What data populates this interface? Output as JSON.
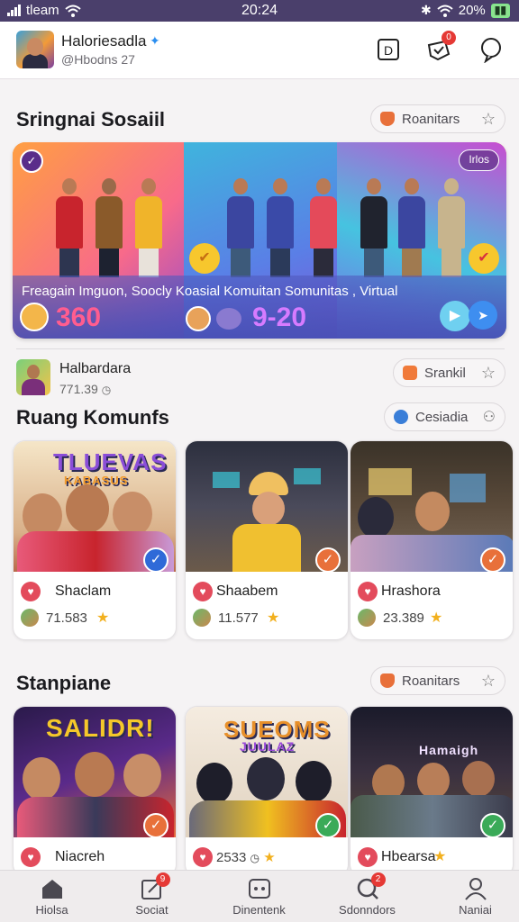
{
  "status": {
    "carrier": "tleam",
    "time": "20:24",
    "battery": "20%"
  },
  "profile": {
    "name": "Haloriesadla",
    "handle": "@Hbodns 27"
  },
  "header_icons": {
    "notification_badge": "0"
  },
  "section1": {
    "title": "Sringnai Sosaiil",
    "chip_label": "Roanitars",
    "banner": {
      "tag": "Irlos",
      "caption": "Freagain Imguon, Soocly Koasial Komuitan Somunitas , Virtual",
      "stat_a": "360",
      "stat_b": "9-20"
    }
  },
  "featured_user": {
    "name": "Halbardara",
    "stat": "771.39",
    "chip_label": "Srankil"
  },
  "section2": {
    "title": "Ruang Komunfs",
    "chip_label": "Cesiadia",
    "cards": [
      {
        "scene_text": "TLUEVAS",
        "scene_sub": "KABASUS",
        "title": "Shaclam",
        "stat": "71.583"
      },
      {
        "scene_text": "",
        "scene_sub": "",
        "title": "Shaabem",
        "stat": "11.577"
      },
      {
        "scene_text": "",
        "scene_sub": "",
        "title": "Hrashora",
        "stat": "23.389"
      }
    ]
  },
  "section3": {
    "title": "Stanpiane",
    "chip_label": "Roanitars",
    "cards": [
      {
        "scene_text": "SALIDR!",
        "title": "Niacreh",
        "stat": ""
      },
      {
        "scene_text": "SUEOMS",
        "scene_sub": "JUULAZ",
        "title": "",
        "stat": "2533"
      },
      {
        "scene_text": "Hamaigh",
        "title": "Hbearsa",
        "stat": ""
      }
    ]
  },
  "tabs": [
    {
      "label": "Hiolsa",
      "icon": "home-icon"
    },
    {
      "label": "Sociat",
      "icon": "edit-icon",
      "badge": "9"
    },
    {
      "label": "Dinentenk",
      "icon": "chat-icon"
    },
    {
      "label": "Sdonndors",
      "icon": "search-icon",
      "badge": "2"
    },
    {
      "label": "Naniai",
      "icon": "profile-icon"
    }
  ],
  "colors": {
    "status_bg": "#4a3f6b",
    "accent_red": "#e34b5c",
    "check_orange": "#e8703a",
    "check_blue": "#2f6ad8",
    "check_green": "#3aaa58"
  }
}
